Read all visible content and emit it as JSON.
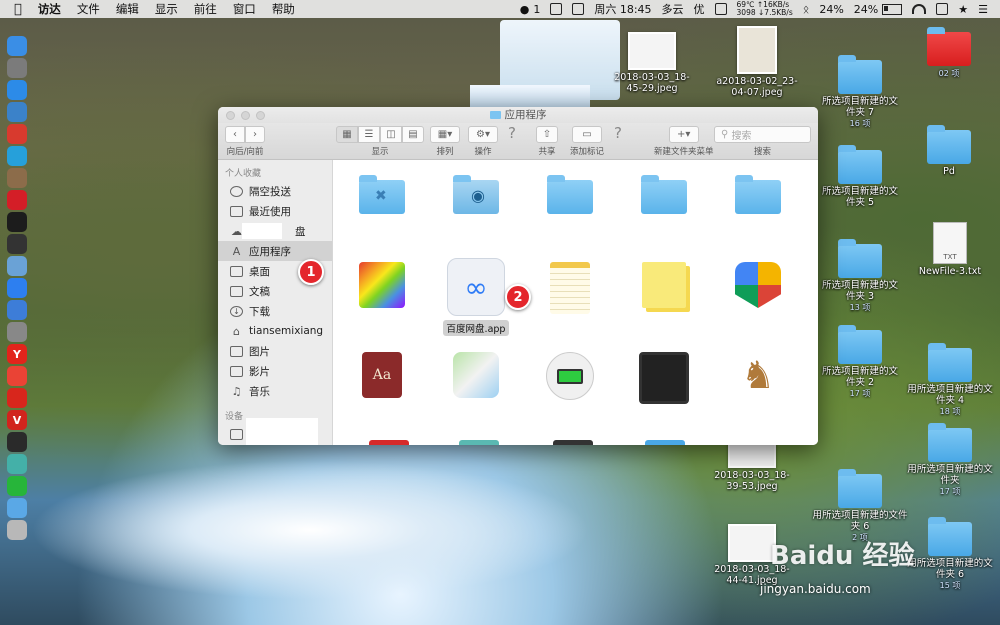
{
  "menubar": {
    "app_name": "访达",
    "menus": [
      "文件",
      "编辑",
      "显示",
      "前往",
      "窗口",
      "帮助"
    ],
    "wechat_count": "1",
    "clock": "周六 18:45",
    "weather": "多云",
    "air": "优",
    "cpu_temp": "69℃",
    "fan": "3098",
    "net_up": "↑16KB/s",
    "net_down": "↓7.5KB/s",
    "battery_text_1": "24%",
    "battery_text_2": "24%"
  },
  "dock": {
    "colors": [
      "#3a8ee6",
      "#7b7b7b",
      "#2c8be8",
      "#3b82c9",
      "#d83a2e",
      "#26a0da",
      "#8c6c4a",
      "#d41e27",
      "#1c1c1c",
      "#333333",
      "#6aa2d6",
      "#2d7ff0",
      "#3d7dd8",
      "#888888",
      "#e2241b",
      "#ea4335",
      "#d8261c",
      "#d1241d",
      "#2a2a2a",
      "#44b0a8",
      "#27b53a",
      "#5aa8e6",
      "#b8b8b8"
    ],
    "letters": [
      "",
      "",
      "",
      "",
      "",
      "",
      "",
      "",
      "",
      "",
      "",
      "",
      "",
      "",
      "Y",
      "",
      "",
      "V",
      "",
      "",
      "",
      "",
      ""
    ]
  },
  "finder": {
    "title": "应用程序",
    "toolbar": {
      "back_forward_label": "向后/向前",
      "view_label": "显示",
      "arrange_label": "排列",
      "action_label": "操作",
      "share_label": "共享",
      "tag_label": "添加标记",
      "new_folder_label": "新建文件夹菜单",
      "search_label": "搜索",
      "search_placeholder": "搜索"
    },
    "sidebar": {
      "favorites_header": "个人收藏",
      "items": [
        {
          "icon": "airdrop-icon",
          "label": "隔空投送"
        },
        {
          "icon": "recents-icon",
          "label": "最近使用"
        },
        {
          "icon": "cloud-icon",
          "label": "盘"
        },
        {
          "icon": "applications-icon",
          "label": "应用程序"
        },
        {
          "icon": "desktop-icon",
          "label": "桌面"
        },
        {
          "icon": "documents-icon",
          "label": "文稿"
        },
        {
          "icon": "downloads-icon",
          "label": "下载"
        },
        {
          "icon": "home-icon",
          "label": "tiansemixiang"
        },
        {
          "icon": "pictures-icon",
          "label": "图片"
        },
        {
          "icon": "movies-icon",
          "label": "影片"
        },
        {
          "icon": "music-icon",
          "label": "音乐"
        }
      ],
      "devices_header": "设备"
    },
    "content": {
      "selected_app_label": "百度网盘.app"
    }
  },
  "badges": {
    "one": "1",
    "two": "2"
  },
  "desktop": {
    "top_thumbs": [
      "2018-03-03_18-45-29.jpeg",
      "a2018-03-02_23-04-07.jpeg"
    ],
    "right_col1": [
      {
        "label": "所选项目新建的文件夹 7",
        "sub": "16 项"
      },
      {
        "label": "所选项目新建的文件夹 5",
        "sub": ""
      },
      {
        "label": "所选项目新建的文件夹 3",
        "sub": "13 项"
      },
      {
        "label": "所选项目新建的文件夹 2",
        "sub": "17 项"
      },
      {
        "label": "用所选项目新建的文件夹 6",
        "sub": "2 项"
      }
    ],
    "right_col2": [
      {
        "label": "",
        "sub": "02 项"
      },
      {
        "label": "Pd",
        "sub": ""
      },
      {
        "label": "NewFile-3.txt",
        "sub": ""
      },
      {
        "label": "用所选项目新建的文件夹 4",
        "sub": "18 项"
      },
      {
        "label": "用所选项目新建的文件夹",
        "sub": "17 项"
      },
      {
        "label": "用所选项目新建的文件夹 6",
        "sub": "15 项"
      }
    ],
    "txt_tag": "TXT",
    "mid_thumbs": [
      "2018-03-03_18-39-53.jpeg",
      "2018-03-03_18-44-41.jpeg"
    ]
  },
  "watermark": {
    "brand": "Baidu 经验",
    "url": "jingyan.baidu.com"
  }
}
